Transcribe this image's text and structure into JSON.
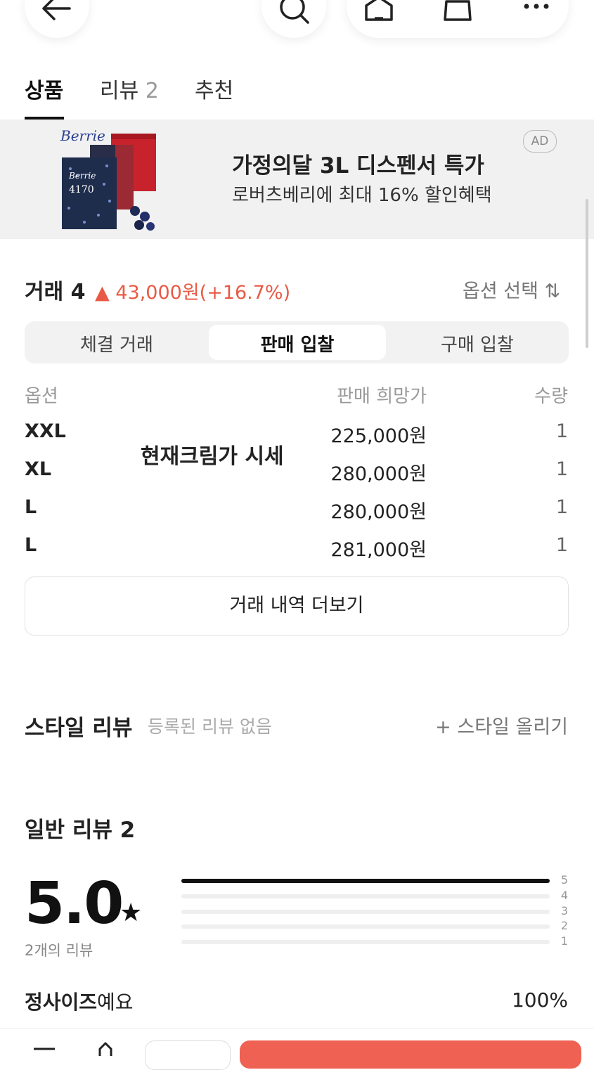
{
  "header": {
    "back_icon": "arrow-left-icon",
    "search_icon": "search-icon",
    "home_icon": "home-icon",
    "bag_icon": "shopping-bag-icon",
    "more_icon": "more-horizontal-icon"
  },
  "tabs": [
    {
      "label": "상품",
      "count": ""
    },
    {
      "label": "리뷰",
      "count": "2"
    },
    {
      "label": "추천",
      "count": ""
    }
  ],
  "ad": {
    "title": "가정의달 3L 디스펜서 특가",
    "subtitle": "로버츠베리에 최대 16% 할인혜택",
    "badge": "AD",
    "brand": "Berrie",
    "box_text": "4170"
  },
  "trades": {
    "title": "거래 4",
    "change": "▲ 43,000원(+16.7%)",
    "option_select": "옵션 선택 ⇅",
    "segments": [
      "체결 거래",
      "판매 입찰",
      "구매 입찰"
    ],
    "active_segment": 1,
    "columns": {
      "option": "옵션",
      "price": "판매 희망가",
      "qty": "수량"
    },
    "rows": [
      {
        "option": "XXL",
        "price": "225,000원",
        "qty": "1"
      },
      {
        "option": "XL",
        "price": "280,000원",
        "qty": "1"
      },
      {
        "option": "L",
        "price": "280,000원",
        "qty": "1"
      },
      {
        "option": "L",
        "price": "281,000원",
        "qty": "1"
      }
    ],
    "overlay_text": "현재크림가 시세",
    "more_button": "거래 내역 더보기"
  },
  "style_review": {
    "title": "스타일 리뷰",
    "empty_text": "등록된 리뷰 없음",
    "upload_label": "+ 스타일 올리기"
  },
  "general_review": {
    "title": "일반 리뷰 2",
    "score": "5.0",
    "star": "★",
    "count_label": "2개의 리뷰",
    "distribution": [
      {
        "stars": "5",
        "fraction": 1.0
      },
      {
        "stars": "4",
        "fraction": 0
      },
      {
        "stars": "3",
        "fraction": 0
      },
      {
        "stars": "2",
        "fraction": 0
      },
      {
        "stars": "1",
        "fraction": 0
      }
    ],
    "size_fit_label_bold": "정사이즈",
    "size_fit_label_rest": "예요",
    "size_fit_pct": "100%"
  },
  "colors": {
    "accent_red": "#ef6253",
    "change_red": "#e85a45"
  }
}
